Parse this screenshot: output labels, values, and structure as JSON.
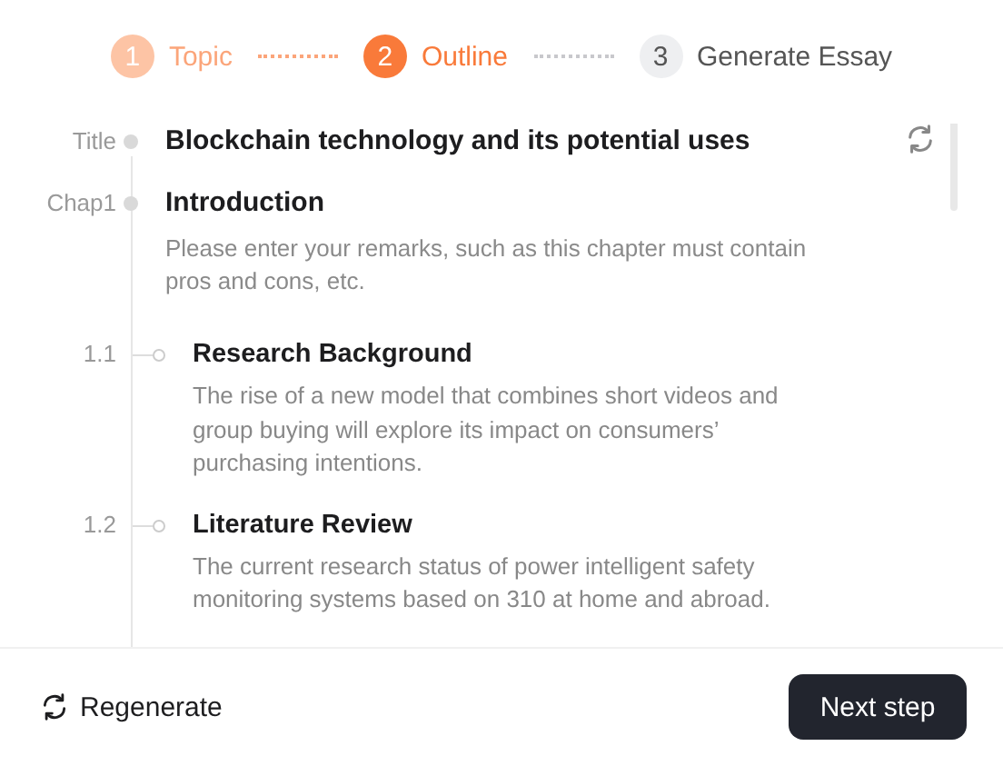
{
  "steps": [
    {
      "number": "1",
      "label": "Topic",
      "completed": true,
      "selected": false
    },
    {
      "number": "2",
      "label": "Outline",
      "completed": false,
      "selected": true
    },
    {
      "number": "3",
      "label": "Generate Essay",
      "completed": false,
      "selected": false
    }
  ],
  "outline": {
    "title_label": "Title",
    "title": "Blockchain technology and its potential uses",
    "chapters": [
      {
        "label": "Chap1",
        "heading": "Introduction",
        "placeholder": "Please enter your remarks, such as this chapter must contain pros and cons, etc.",
        "children": [
          {
            "label": "1.1",
            "heading": "Research Background",
            "text": "The rise of a new model that combines short videos and group buying will explore its impact on consumers’ purchasing intentions."
          },
          {
            "label": "1.2",
            "heading": "Literature Review",
            "text": "The current research status of power intelligent safety monitoring systems based on 310 at home and abroad."
          }
        ]
      }
    ]
  },
  "footer": {
    "regenerate": "Regenerate",
    "next": "Next step"
  }
}
